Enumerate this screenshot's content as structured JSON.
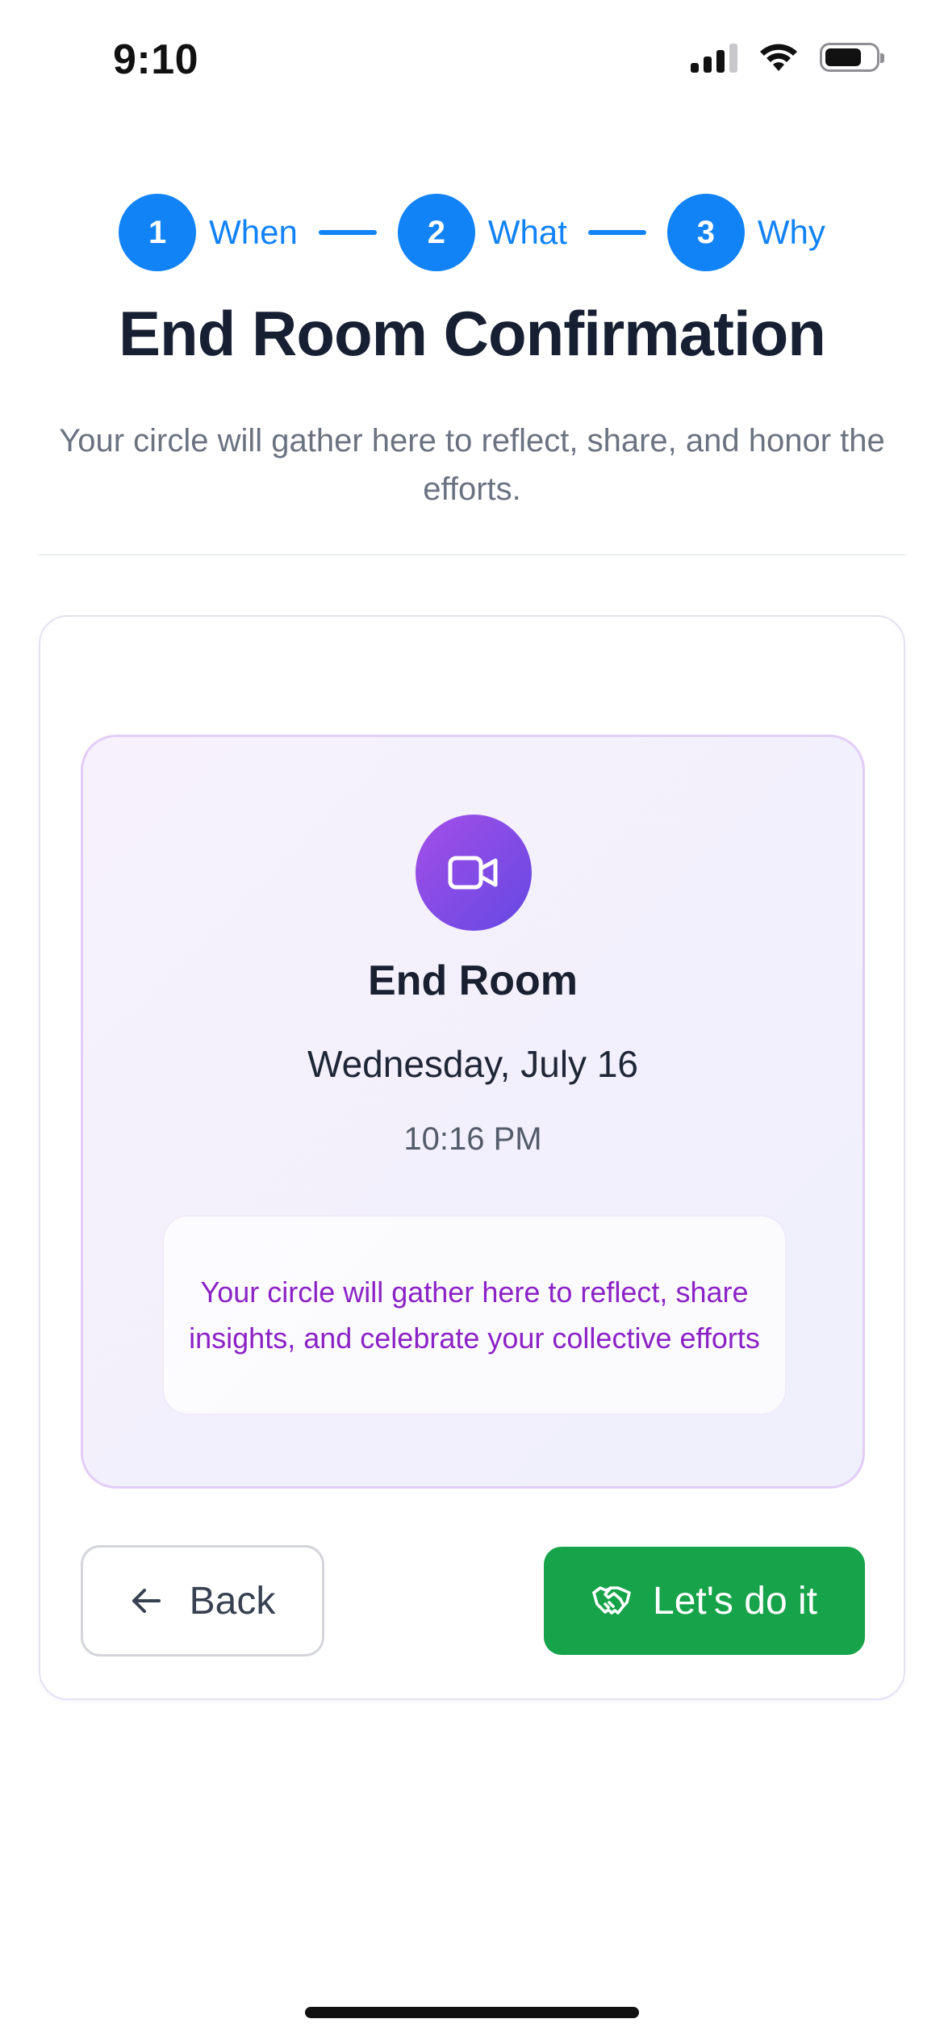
{
  "status_bar": {
    "time": "9:10",
    "icons": [
      "cellular-signal-icon",
      "wifi-icon",
      "battery-icon"
    ]
  },
  "stepper": {
    "steps": [
      {
        "number": "1",
        "label": "When"
      },
      {
        "number": "2",
        "label": "What"
      },
      {
        "number": "3",
        "label": "Why"
      }
    ],
    "active_color": "#1183f7"
  },
  "header": {
    "title": "End Room Confirmation",
    "subtitle": "Your circle will gather here to reflect, share, and honor the efforts."
  },
  "room_card": {
    "icon": "video-camera-icon",
    "title": "End Room",
    "date": "Wednesday, July 16",
    "time": "10:16 PM",
    "note": "Your circle will gather here to reflect, share insights, and celebrate your collective efforts"
  },
  "actions": {
    "back_label": "Back",
    "back_icon": "arrow-left-icon",
    "confirm_label": "Let's do it",
    "confirm_icon": "handshake-icon",
    "confirm_color": "#17a34a"
  },
  "colors": {
    "accent": "#1183f7",
    "purple": "#8b22c5",
    "success": "#17a34a"
  }
}
